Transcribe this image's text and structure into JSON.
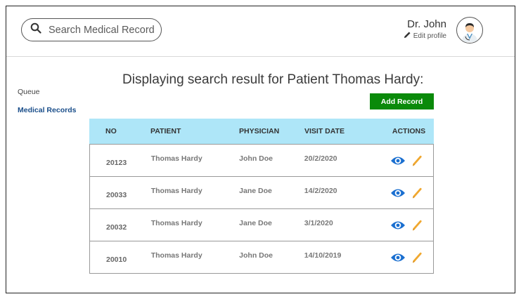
{
  "header": {
    "search": {
      "placeholder": "Search Medical Record"
    },
    "user": {
      "name": "Dr. John",
      "edit_label": "Edit profile"
    }
  },
  "sidebar": {
    "items": [
      {
        "label": "Queue",
        "active": false
      },
      {
        "label": "Medical Records",
        "active": true
      }
    ]
  },
  "main": {
    "title": "Displaying search result for Patient Thomas Hardy:",
    "add_button": "Add Record",
    "table": {
      "columns": [
        "NO",
        "PATIENT",
        "PHYSICIAN",
        "VISIT DATE",
        "ACTIONS"
      ],
      "rows": [
        {
          "no": "20123",
          "patient": "Thomas Hardy",
          "physician": "John Doe",
          "visit_date": "20/2/2020"
        },
        {
          "no": "20033",
          "patient": "Thomas Hardy",
          "physician": "Jane Doe",
          "visit_date": "14/2/2020"
        },
        {
          "no": "20032",
          "patient": "Thomas Hardy",
          "physician": "Jane Doe",
          "visit_date": "3/1/2020"
        },
        {
          "no": "20010",
          "patient": "Thomas Hardy",
          "physician": "John Doe",
          "visit_date": "14/10/2019"
        }
      ]
    }
  },
  "colors": {
    "accent_blue": "#1a4e8a",
    "add_green": "#0a8a0a",
    "header_cyan": "#aee6f8",
    "view_icon": "#1a6fd0",
    "edit_icon": "#f0a830"
  },
  "icons": {
    "search": "magnifier-icon",
    "edit_profile": "pencil-icon",
    "avatar": "doctor-avatar-icon",
    "view": "eye-icon",
    "edit": "pencil-icon"
  }
}
